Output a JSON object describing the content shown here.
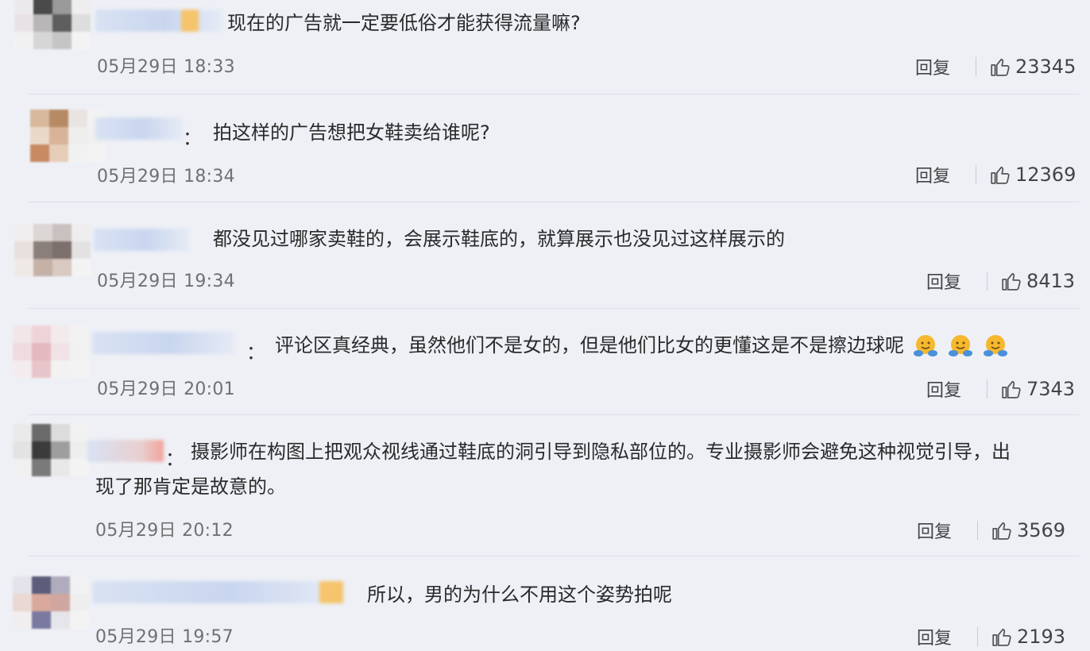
{
  "labels": {
    "reply": "回复"
  },
  "comments": [
    {
      "sep": "：",
      "text": "现在的广告就一定要低俗才能获得流量嘛?",
      "time": "05月29日 18:33",
      "likes": "23345"
    },
    {
      "sep": "：",
      "text": "拍这样的广告想把女鞋卖给谁呢?",
      "time": "05月29日 18:34",
      "likes": "12369"
    },
    {
      "sep": "：",
      "text": "都没见过哪家卖鞋的，会展示鞋底的，就算展示也没见过这样展示的",
      "time": "05月29日 19:34",
      "likes": "8413"
    },
    {
      "sep": "：",
      "text": "评论区真经典，虽然他们不是女的，但是他们比女的更懂这是不是擦边球呢",
      "time": "05月29日 20:01",
      "likes": "7343",
      "emojis": [
        "hug-emoji",
        "hug-emoji",
        "hug-emoji"
      ]
    },
    {
      "sep": "：",
      "text_line1": "摄影师在构图上把观众视线通过鞋底的洞引导到隐私部位的。专业摄影师会避免这种视觉引导，出",
      "text_line2": "现了那肯定是故意的。",
      "time": "05月29日 20:12",
      "likes": "3569"
    },
    {
      "sep": "：",
      "text": "所以，男的为什么不用这个姿势拍呢",
      "time": "05月29日 19:57",
      "likes": "2193"
    }
  ],
  "colors": {
    "background": "#eef0f6",
    "separator": "#dcdfe6",
    "time": "#707070",
    "emoji": "#f5b82e"
  },
  "icons": {
    "like": "thumbs-up-icon"
  }
}
